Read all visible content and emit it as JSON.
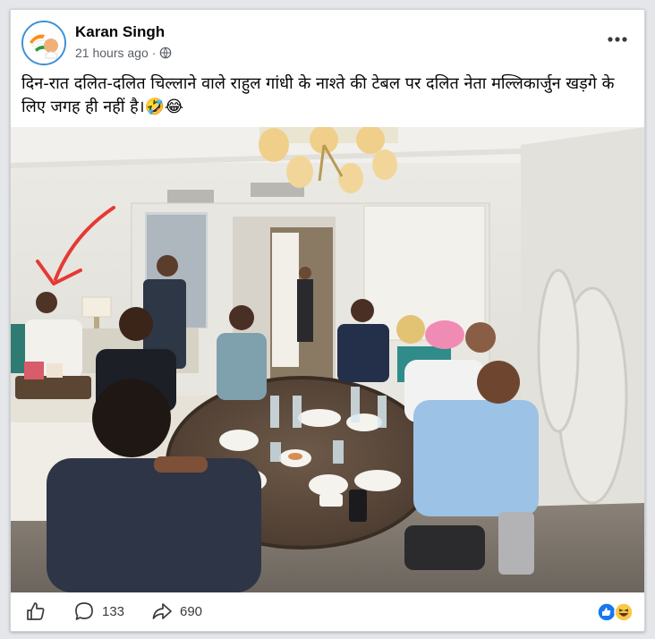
{
  "post": {
    "author": "Karan Singh",
    "time": "21 hours ago",
    "separator": "·",
    "text": "दिन-रात दलित-दलित चिल्लाने वाले राहुल गांधी के नाश्ते की टेबल पर दलित नेता मल्लिकार्जुन खड़गे के लिए जगह ही नहीं है।🤣😂",
    "more_icon": "more-horizontal-icon",
    "privacy_icon": "globe-icon"
  },
  "photo": {
    "subject": "breakfast table meeting photo with red arrow annotation"
  },
  "footer": {
    "like_icon": "thumbs-up-icon",
    "comment_icon": "comment-bubble-icon",
    "comment_count": "133",
    "share_icon": "share-arrow-icon",
    "share_count": "690",
    "reactions": [
      "like-reaction-icon",
      "haha-reaction-icon"
    ]
  },
  "colors": {
    "like_blue": "#1877f2",
    "haha_yellow": "#f7c948",
    "annotation_red": "#e53935"
  }
}
